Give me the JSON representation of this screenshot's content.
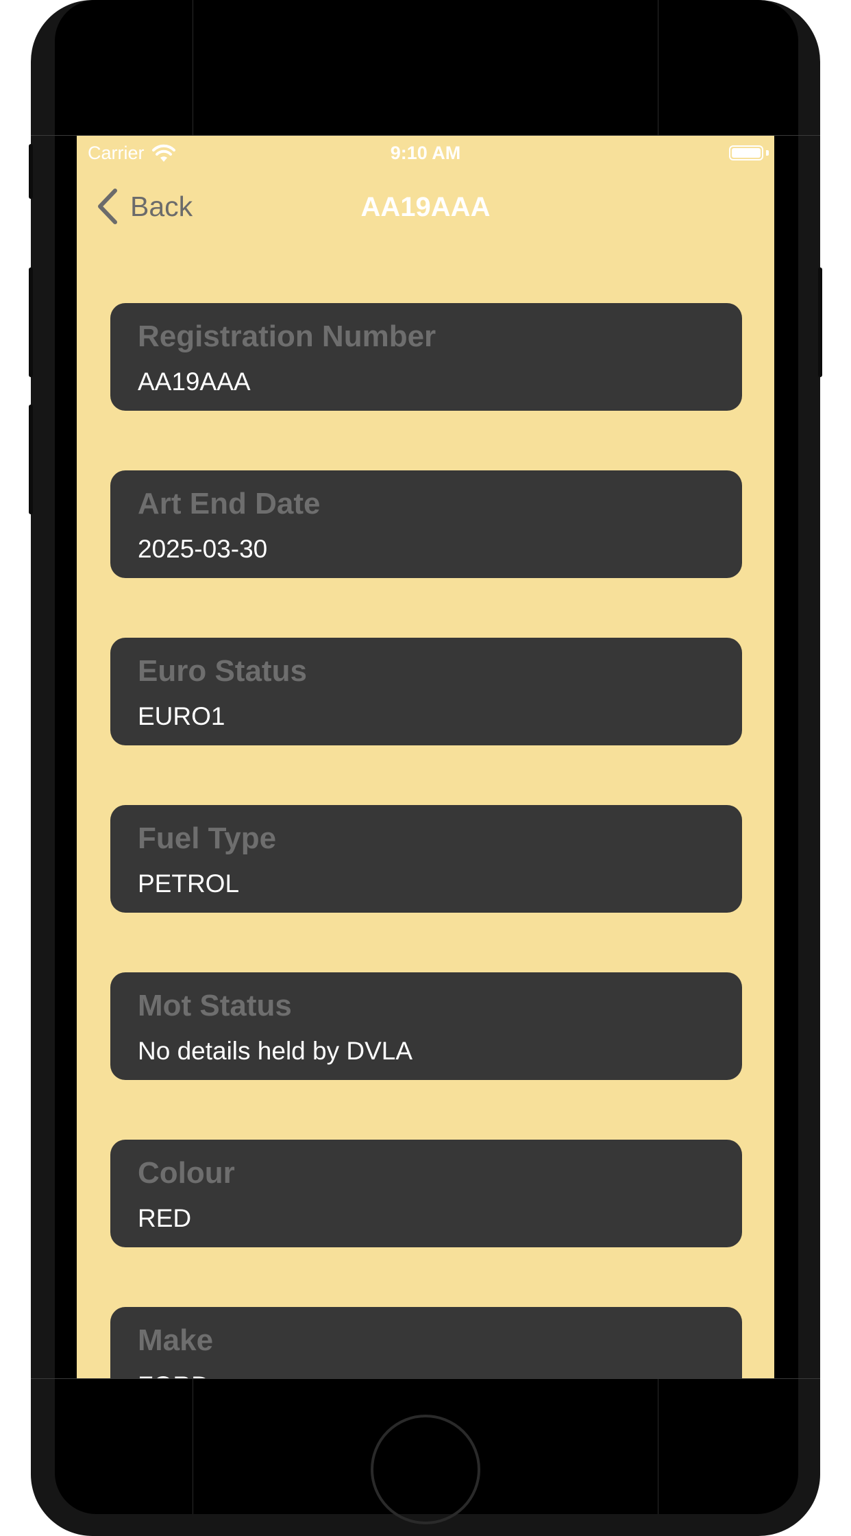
{
  "statusbar": {
    "carrier": "Carrier",
    "time": "9:10 AM",
    "icons": [
      "wifi-icon",
      "battery-icon"
    ]
  },
  "navbar": {
    "back_label": "Back",
    "title": "AA19AAA",
    "back_icon": "chevron-left-icon"
  },
  "fields": [
    {
      "label": "Registration Number",
      "value": "AA19AAA"
    },
    {
      "label": "Art End Date",
      "value": "2025-03-30"
    },
    {
      "label": "Euro Status",
      "value": "EURO1"
    },
    {
      "label": "Fuel Type",
      "value": "PETROL"
    },
    {
      "label": "Mot Status",
      "value": "No details held by DVLA"
    },
    {
      "label": "Colour",
      "value": "RED"
    },
    {
      "label": "Make",
      "value": "FORD"
    }
  ],
  "colors": {
    "screen_background": "#f7e09a",
    "card_background": "#373737",
    "label_text": "#6e6e6e",
    "value_text": "#ffffff"
  }
}
